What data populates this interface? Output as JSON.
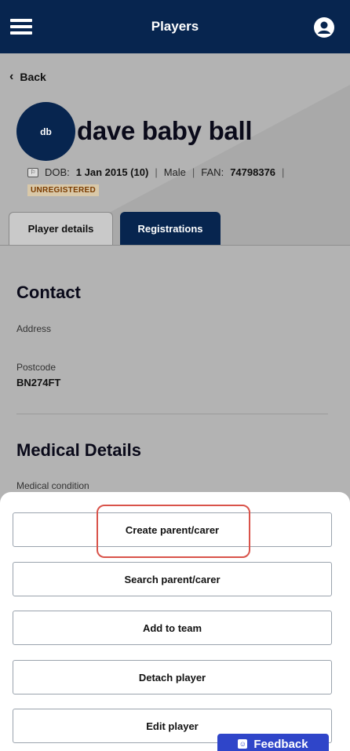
{
  "header": {
    "title": "Players",
    "menu_icon": "hamburger-menu-icon",
    "account_icon": "user-account-icon"
  },
  "back_label": "Back",
  "player": {
    "initials": "db",
    "name": "dave baby ball",
    "dob_label": "DOB:",
    "dob_value": "1 Jan 2015 (10)",
    "gender": "Male",
    "fan_label": "FAN:",
    "fan_value": "74798376",
    "status": "UNREGISTERED"
  },
  "tabs": [
    {
      "label": "Player details",
      "active": false
    },
    {
      "label": "Registrations",
      "active": true
    }
  ],
  "contact": {
    "title": "Contact",
    "address_label": "Address",
    "postcode_label": "Postcode",
    "postcode_value": "BN274FT"
  },
  "medical": {
    "title": "Medical Details",
    "condition_label": "Medical condition"
  },
  "actions": [
    {
      "label": "Create parent/carer"
    },
    {
      "label": "Search parent/carer"
    },
    {
      "label": "Add to team"
    },
    {
      "label": "Detach player"
    },
    {
      "label": "Edit player"
    }
  ],
  "feedback_label": "Feedback",
  "colors": {
    "navy": "#07254f",
    "highlight": "#d9534a",
    "feedback": "#2f45c9",
    "badge_bg": "#d9c8a8",
    "badge_text": "#7a3b00"
  }
}
